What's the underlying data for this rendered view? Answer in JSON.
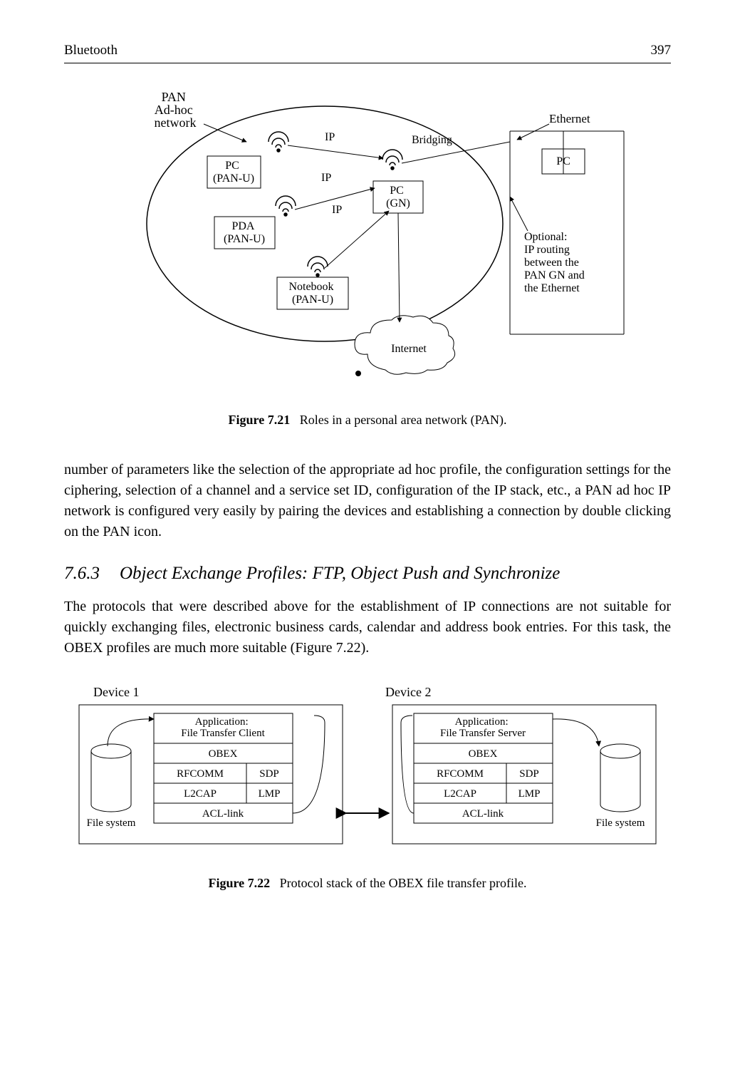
{
  "header": {
    "left": "Bluetooth",
    "right": "397"
  },
  "fig721": {
    "label": "PAN\nAd-hoc\nnetwork",
    "pc_panu": "PC\n(PAN-U)",
    "pda_panu": "PDA\n(PAN-U)",
    "nb_panu": "Notebook\n(PAN-U)",
    "pc_gn": "PC\n(GN)",
    "pc_eth": "PC",
    "eth": "Ethernet",
    "ip": "IP",
    "bridging": "Bridging",
    "optional": "Optional:\nIP routing\nbetween the\nPAN GN and\nthe Ethernet",
    "internet": "Internet",
    "cap_bold": "Figure 7.21",
    "cap_rest": "Roles in a personal area network (PAN)."
  },
  "para1": "number of parameters like the selection of the appropriate ad hoc profile, the configuration settings for the ciphering, selection of a channel and a service set ID, configuration of the IP stack, etc., a PAN ad hoc IP network is configured very easily by pairing the devices and establishing a connection by double clicking on the PAN icon.",
  "sect": {
    "num": "7.6.3",
    "title": "Object Exchange Profiles: FTP, Object Push and Synchronize"
  },
  "para2": "The protocols that were described above for the establishment of IP connections are not suitable for quickly exchanging files, electronic business cards, calendar and address book entries. For this task, the OBEX profiles are much more suitable (Figure 7.22).",
  "fig722": {
    "dev1": "Device 1",
    "dev2": "Device 2",
    "app_c": "Application:\nFile Transfer Client",
    "app_s": "Application:\nFile Transfer Server",
    "obex": "OBEX",
    "rfcomm": "RFCOMM",
    "sdp": "SDP",
    "l2cap": "L2CAP",
    "lmp": "LMP",
    "acl": "ACL-link",
    "fs": "File system",
    "cap_bold": "Figure 7.22",
    "cap_rest": "Protocol stack of the OBEX file transfer profile."
  }
}
